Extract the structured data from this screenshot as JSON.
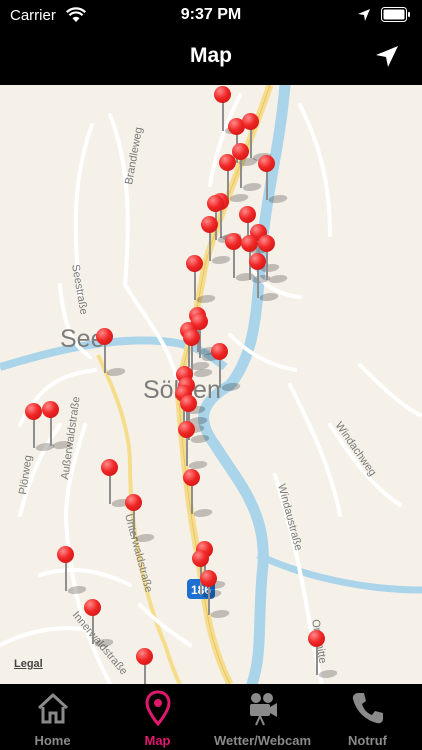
{
  "status_bar": {
    "carrier": "Carrier",
    "time": "9:37 PM"
  },
  "nav": {
    "title": "Map"
  },
  "map": {
    "labels": {
      "town_1": "See",
      "town_2": "Sölden",
      "road_badge": "186"
    },
    "streets": [
      "Brandleweg",
      "Seestraße",
      "Außerwaldstraße",
      "Plörweg",
      "Unterwaldstraße",
      "Innerwaldstraße",
      "Windachweg",
      "Windaustraße",
      "Ortsmitte"
    ],
    "legal": "Legal",
    "pin_count": 44
  },
  "tabs": [
    {
      "label": "Home",
      "icon": "home-icon"
    },
    {
      "label": "Map",
      "icon": "map-pin-icon",
      "active": true
    },
    {
      "label": "Wetter/Webcam",
      "icon": "camera-icon"
    },
    {
      "label": "Notruf",
      "icon": "phone-icon"
    }
  ],
  "colors": {
    "accent": "#e0186e",
    "pin": "#e82020",
    "river": "#a9d4ea"
  }
}
